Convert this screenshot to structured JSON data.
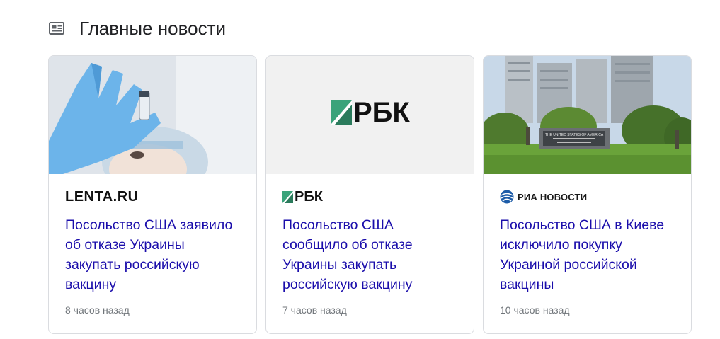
{
  "section": {
    "title": "Главные новости",
    "icon": "newspaper-icon"
  },
  "cards": [
    {
      "source": "LENTA.RU",
      "headline": "Посольство США заявило об отказе Украины закупать российскую вакцину",
      "time": "8 часов назад",
      "image": "vaccine-photo"
    },
    {
      "source": "РБК",
      "headline": "Посольство США сообщило об отказе Украины закупать российскую вакцину",
      "time": "7 часов назад",
      "image": "rbk-logo",
      "image_text": "РБК"
    },
    {
      "source": "РИА НОВОСТИ",
      "headline": "Посольство США в Киеве исключило покупку Украиной российской вакцины",
      "time": "10 часов назад",
      "image": "embassy-photo",
      "sign_text": "THE UNITED STATES OF AMERICA"
    }
  ],
  "colors": {
    "link": "#1a0dab",
    "meta": "#70757a",
    "rbk_green": "#3aa37a"
  }
}
